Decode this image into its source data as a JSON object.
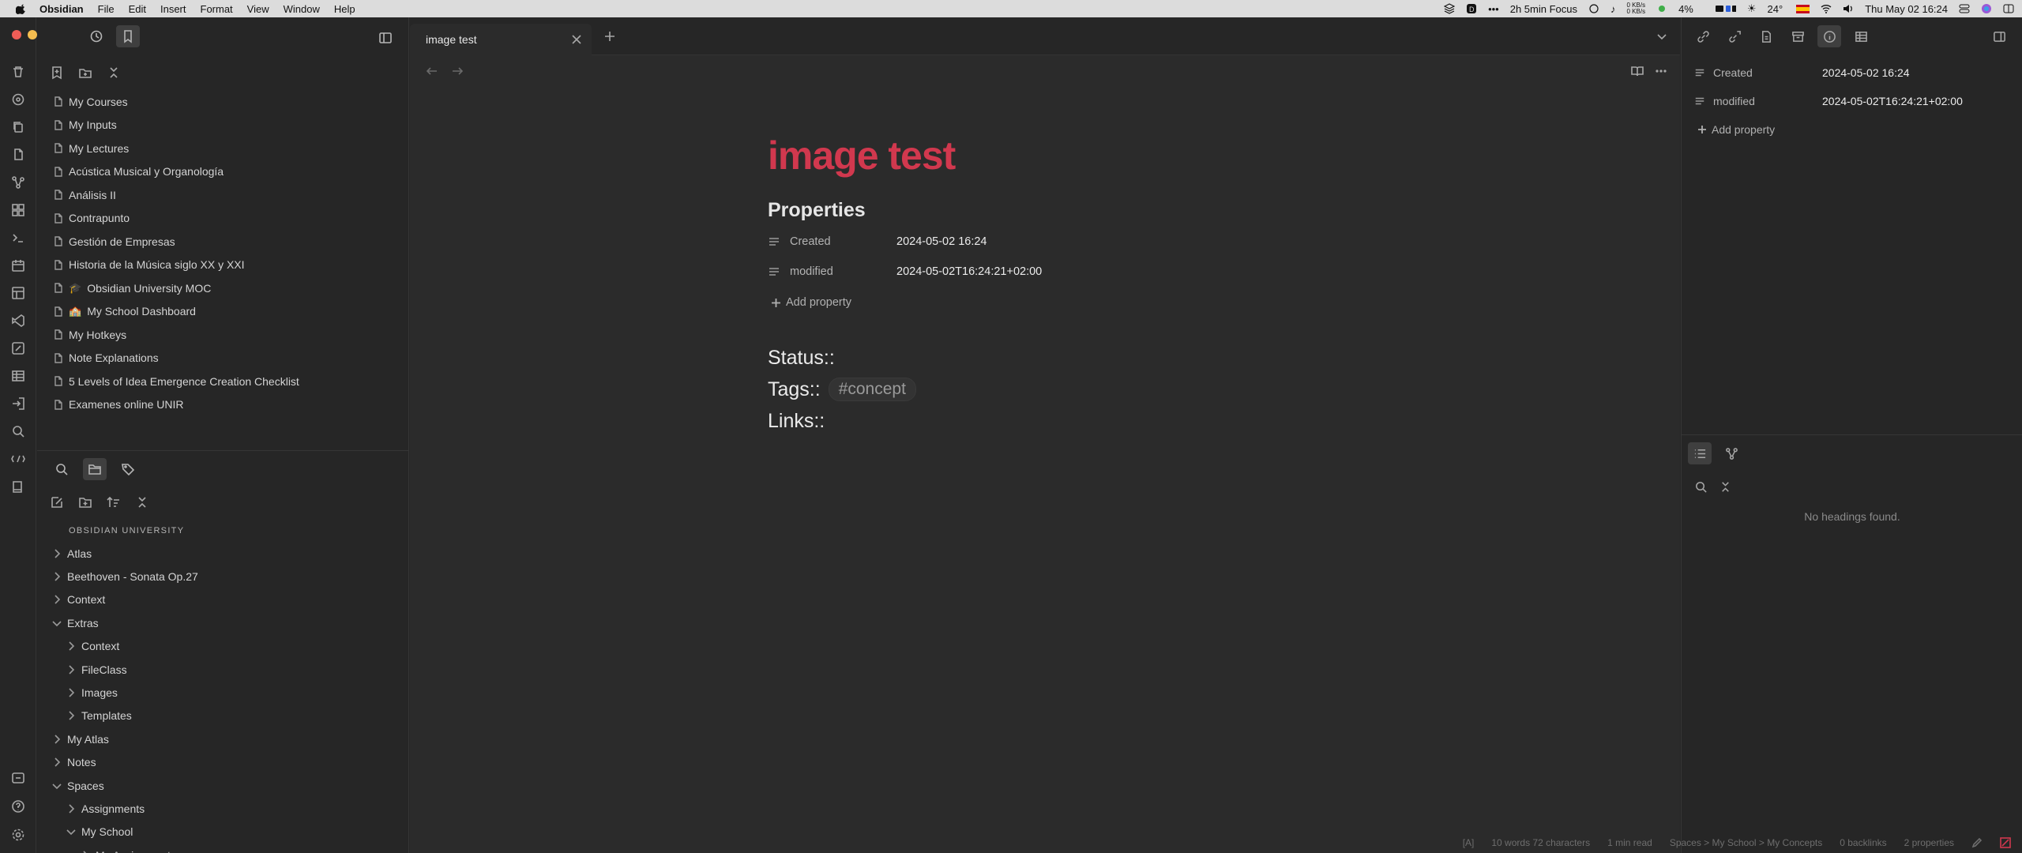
{
  "menubar": {
    "app": "Obsidian",
    "menus": [
      "File",
      "Edit",
      "Insert",
      "Format",
      "View",
      "Window",
      "Help"
    ],
    "focus": "2h 5min Focus",
    "net_up": "0 KB/s",
    "net_down": "0 KB/s",
    "battery": "4%",
    "weather": "24°",
    "datetime": "Thu May 02 16:24"
  },
  "bookmarks": [
    {
      "label": "My Courses"
    },
    {
      "label": "My Inputs"
    },
    {
      "label": "My Lectures"
    },
    {
      "label": "Acústica Musical y Organología"
    },
    {
      "label": "Análisis II"
    },
    {
      "label": "Contrapunto"
    },
    {
      "label": "Gestión de Empresas"
    },
    {
      "label": "Historia de la Música siglo XX y XXI"
    },
    {
      "label": "Obsidian University MOC",
      "emoji": "🎓"
    },
    {
      "label": "My School Dashboard",
      "emoji": "🏫"
    },
    {
      "label": "My Hotkeys"
    },
    {
      "label": "Note Explanations"
    },
    {
      "label": "5 Levels of Idea Emergence Creation Checklist"
    },
    {
      "label": "Examenes online UNIR"
    }
  ],
  "explorer": {
    "vault": "OBSIDIAN UNIVERSITY",
    "items": [
      {
        "label": "Atlas",
        "depth": 0,
        "expanded": false
      },
      {
        "label": "Beethoven - Sonata Op.27",
        "depth": 0,
        "expanded": false
      },
      {
        "label": "Context",
        "depth": 0,
        "expanded": false
      },
      {
        "label": "Extras",
        "depth": 0,
        "expanded": true
      },
      {
        "label": "Context",
        "depth": 1,
        "expanded": false
      },
      {
        "label": "FileClass",
        "depth": 1,
        "expanded": false
      },
      {
        "label": "Images",
        "depth": 1,
        "expanded": false
      },
      {
        "label": "Templates",
        "depth": 1,
        "expanded": false
      },
      {
        "label": "My Atlas",
        "depth": 0,
        "expanded": false
      },
      {
        "label": "Notes",
        "depth": 0,
        "expanded": false
      },
      {
        "label": "Spaces",
        "depth": 0,
        "expanded": true
      },
      {
        "label": "Assignments",
        "depth": 1,
        "expanded": false
      },
      {
        "label": "My School",
        "depth": 1,
        "expanded": true
      },
      {
        "label": "My Assignments",
        "depth": 2,
        "expanded": false
      }
    ]
  },
  "tab": {
    "title": "image test"
  },
  "note": {
    "title": "image test",
    "properties_heading": "Properties",
    "properties": [
      {
        "key": "Created",
        "value": "2024-05-02 16:24"
      },
      {
        "key": "modified",
        "value": "2024-05-02T16:24:21+02:00"
      }
    ],
    "add_property": "Add property",
    "status_label": "Status::",
    "tags_label": "Tags::",
    "tag": "#concept",
    "links_label": "Links::"
  },
  "right_panel": {
    "properties": [
      {
        "key": "Created",
        "value": "2024-05-02 16:24"
      },
      {
        "key": "modified",
        "value": "2024-05-02T16:24:21+02:00"
      }
    ],
    "add_property": "Add property",
    "outline_empty": "No headings found."
  },
  "statusbar": {
    "mode": "[A]",
    "counts": "10 words 72 characters",
    "read_time": "1 min read",
    "path": "Spaces > My School > My Concepts",
    "backlinks": "0 backlinks",
    "properties": "2 properties"
  },
  "colors": {
    "title_accent": "#d1384e",
    "background": "#262626",
    "editor_bg": "#2b2b2b"
  }
}
